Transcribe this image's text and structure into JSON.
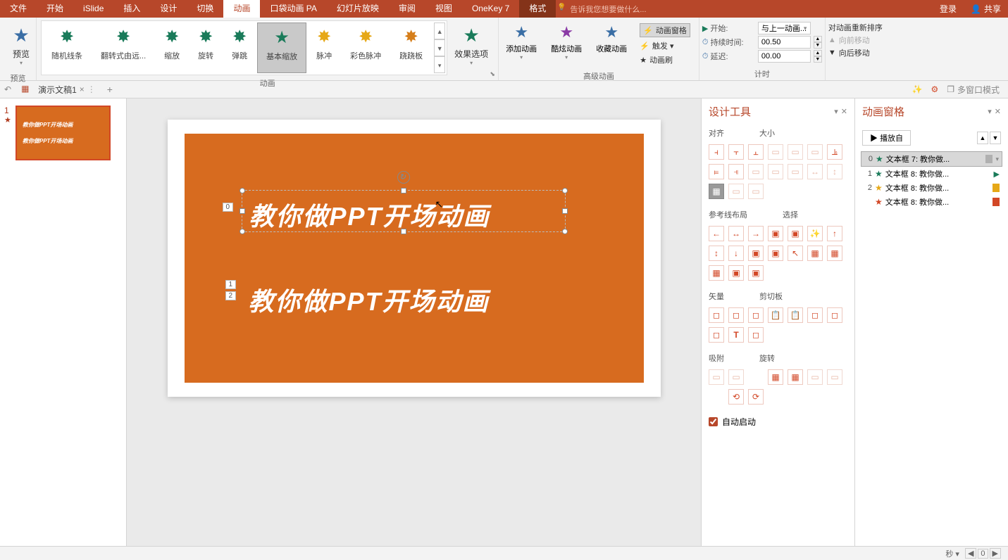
{
  "menubar": {
    "tabs": [
      "文件",
      "开始",
      "iSlide",
      "插入",
      "设计",
      "切换",
      "动画",
      "口袋动画 PA",
      "幻灯片放映",
      "审阅",
      "视图",
      "OneKey 7",
      "格式"
    ],
    "active": "动画",
    "format_tab": "格式",
    "search_hint": "告诉我您想要做什么...",
    "login": "登录",
    "share": "共享"
  },
  "ribbon": {
    "preview": {
      "label": "预览",
      "group": "预览"
    },
    "gallery_items": [
      {
        "label": "随机线条",
        "color": "star-green"
      },
      {
        "label": "翻转式由远...",
        "color": "star-green"
      },
      {
        "label": "缩放",
        "color": "star-green"
      },
      {
        "label": "旋转",
        "color": "star-green"
      },
      {
        "label": "弹跳",
        "color": "star-green"
      },
      {
        "label": "基本缩放",
        "color": "star-green",
        "selected": true
      },
      {
        "label": "脉冲",
        "color": "star-yellow"
      },
      {
        "label": "彩色脉冲",
        "color": "star-yellow"
      },
      {
        "label": "跷跷板",
        "color": "star-orange"
      }
    ],
    "animation_group": "动画",
    "effect_options": "效果选项",
    "add_animation": "添加动画",
    "cool_animation": "酷炫动画",
    "collect_animation": "收藏动画",
    "animation_pane": "动画窗格",
    "trigger": "触发 ▾",
    "animation_painter": "动画刷",
    "advanced_group": "高级动画",
    "timing": {
      "start_label": "开始:",
      "start_value": "与上一动画...",
      "duration_label": "持续时间:",
      "duration_value": "00.50",
      "delay_label": "延迟:",
      "delay_value": "00.00",
      "group": "计时"
    },
    "reorder": {
      "title": "对动画重新排序",
      "move_earlier": "向前移动",
      "move_later": "向后移动"
    }
  },
  "tabstrip": {
    "doc_name": "演示文稿1",
    "multi_window": "多窗口模式"
  },
  "thumbs": {
    "num": "1",
    "text": "教你做PPT开场动画"
  },
  "slide": {
    "text1": "教你做PPT开场动画",
    "text2": "教你做PPT开场动画",
    "tags": {
      "t0": "0",
      "t1": "1",
      "t2": "2"
    }
  },
  "design_panel": {
    "title": "设计工具",
    "align": "对齐",
    "size": "大小",
    "guides": "参考线布局",
    "select": "选择",
    "vector": "矢量",
    "clipboard": "剪切板",
    "snap": "吸附",
    "rotate": "旋转",
    "auto_start": "自动启动"
  },
  "anim_panel": {
    "title": "动画窗格",
    "play": "播放自",
    "items": [
      {
        "num": "0",
        "star_color": "#1a7b5a",
        "label": "文本框 7: 教你做...",
        "bar": "#b0b0b0",
        "selected": true,
        "dd": "▾"
      },
      {
        "num": "1",
        "star_color": "#1a7b5a",
        "label": "文本框 8: 教你做...",
        "bar": "",
        "play_icon": true
      },
      {
        "num": "2",
        "star_color": "#e6a817",
        "label": "文本框 8: 教你做...",
        "bar": "#e6a817"
      },
      {
        "num": "",
        "star_color": "#d24726",
        "label": "文本框 8: 教你做...",
        "bar": "#d24726"
      }
    ],
    "seconds": "秒"
  },
  "status": {
    "page": "0"
  }
}
